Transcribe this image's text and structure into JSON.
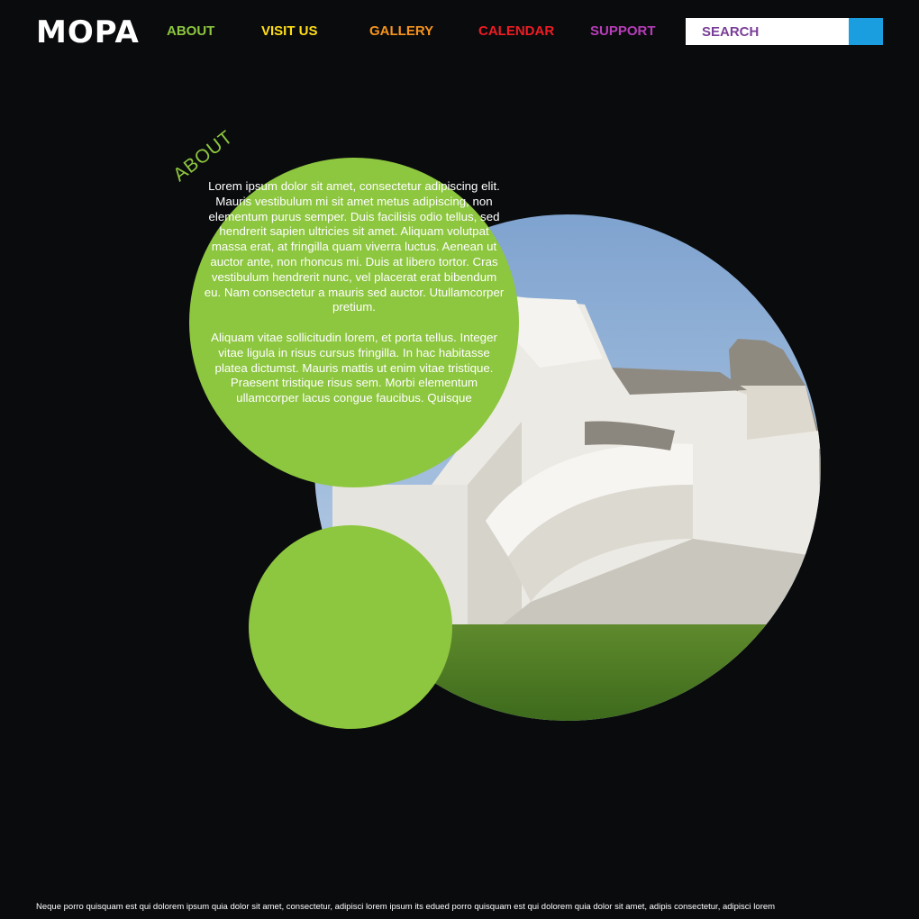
{
  "brand": {
    "logo": "MOPA"
  },
  "nav": {
    "items": [
      {
        "label": "ABOUT",
        "color": "#8dc63f"
      },
      {
        "label": "VISIT US",
        "color": "#ffde17"
      },
      {
        "label": "GALLERY",
        "color": "#f7941d"
      },
      {
        "label": "CALENDAR",
        "color": "#ed1c24"
      },
      {
        "label": "SUPPORT",
        "color": "#b83dba"
      }
    ]
  },
  "search": {
    "placeholder": "SEARCH",
    "button_color": "#1b9ee0"
  },
  "about": {
    "heading": "ABOUT",
    "accent_color": "#8dc63f",
    "paragraphs": [
      "Lorem ipsum dolor sit amet, consectetur adipiscing elit. Mauris vestibulum mi sit amet metus adipiscing, non elementum purus semper. Duis facilisis odio tellus, sed hendrerit sapien ultricies sit amet. Aliquam volutpat massa erat, at fringilla quam viverra luctus. Aenean ut auctor ante, non rhoncus mi. Duis at libero tortor. Cras vestibulum hendrerit nunc, vel placerat erat bibendum eu. Nam consectetur a mauris sed auctor. Utullamcorper pretium.",
      "Aliquam vitae sollicitudin lorem, et porta tellus. Integer vitae ligula in risus cursus fringilla. In hac habitasse platea dictumst. Mauris mattis ut enim vitae tristique. Praesent tristique risus sem. Morbi elementum ullamcorper lacus congue faucibus. Quisque"
    ],
    "image_icon": "building-photo"
  },
  "footer": {
    "text": "Neque porro quisquam est qui dolorem ipsum quia dolor sit amet, consectetur, adipisci lorem ipsum its edued porro quisquam est qui dolorem quia dolor sit amet, adipis  consectetur, adipisci lorem"
  }
}
